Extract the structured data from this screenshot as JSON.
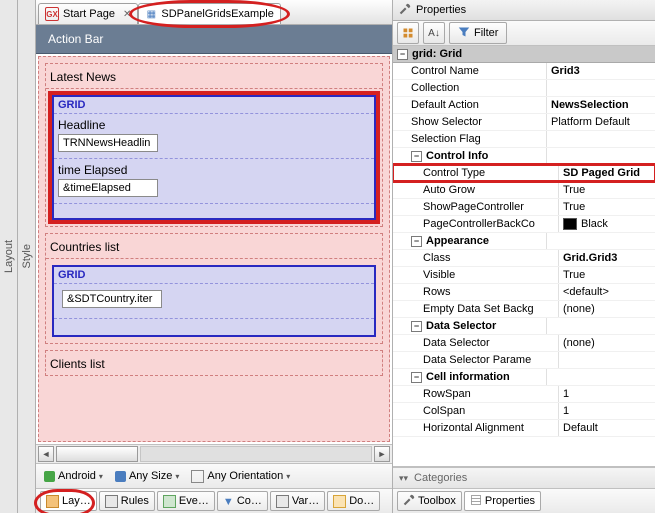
{
  "side_labels": {
    "layout": "Layout",
    "style": "Style"
  },
  "tabs": {
    "start": "Start Page",
    "example": "SDPanelGridsExample"
  },
  "action_bar": {
    "title": "Action Bar"
  },
  "panels": {
    "latest_news": "Latest News",
    "countries": "Countries list",
    "clients": "Clients list"
  },
  "grid1": {
    "header": "GRID",
    "label1": "Headline",
    "field1": "TRNNewsHeadlin",
    "label2": "time Elapsed",
    "field2": "&timeElapsed"
  },
  "grid2": {
    "header": "GRID",
    "field1": "&SDTCountry.iter"
  },
  "config_bar": {
    "android": "Android",
    "size": "Any Size",
    "orientation": "Any Orientation"
  },
  "bottom_tabs": {
    "layout": "Lay…",
    "rules": "Rules",
    "events": "Eve…",
    "conditions": "Co…",
    "variables": "Var…",
    "documentation": "Do…"
  },
  "properties": {
    "panel_title": "Properties",
    "filter": "Filter",
    "header_key": "grid: Grid",
    "rows": {
      "control_name": {
        "k": "Control Name",
        "v": "Grid3"
      },
      "collection": {
        "k": "Collection",
        "v": ""
      },
      "default_action": {
        "k": "Default Action",
        "v": "NewsSelection"
      },
      "show_selector": {
        "k": "Show Selector",
        "v": "Platform Default"
      },
      "selection_flag": {
        "k": "Selection Flag",
        "v": ""
      },
      "control_info": {
        "k": "Control Info"
      },
      "control_type": {
        "k": "Control Type",
        "v": "SD Paged Grid"
      },
      "auto_grow": {
        "k": "Auto Grow",
        "v": "True"
      },
      "show_page_controller": {
        "k": "ShowPageController",
        "v": "True"
      },
      "page_ctrl_back": {
        "k": "PageControllerBackCo",
        "v": "Black"
      },
      "appearance": {
        "k": "Appearance"
      },
      "class": {
        "k": "Class",
        "v": "Grid.Grid3"
      },
      "visible": {
        "k": "Visible",
        "v": "True"
      },
      "rows_": {
        "k": "Rows",
        "v": "<default>"
      },
      "empty_ds": {
        "k": "Empty Data Set Backg",
        "v": "(none)"
      },
      "data_selector_cat": {
        "k": "Data Selector"
      },
      "data_selector": {
        "k": "Data Selector",
        "v": "(none)"
      },
      "data_selector_params": {
        "k": "Data Selector Parame",
        "v": ""
      },
      "cell_info": {
        "k": "Cell information"
      },
      "rowspan": {
        "k": "RowSpan",
        "v": "1"
      },
      "colspan": {
        "k": "ColSpan",
        "v": "1"
      },
      "halign": {
        "k": "Horizontal Alignment",
        "v": "Default"
      }
    },
    "categories": "Categories"
  },
  "right_tabs": {
    "toolbox": "Toolbox",
    "properties": "Properties"
  }
}
